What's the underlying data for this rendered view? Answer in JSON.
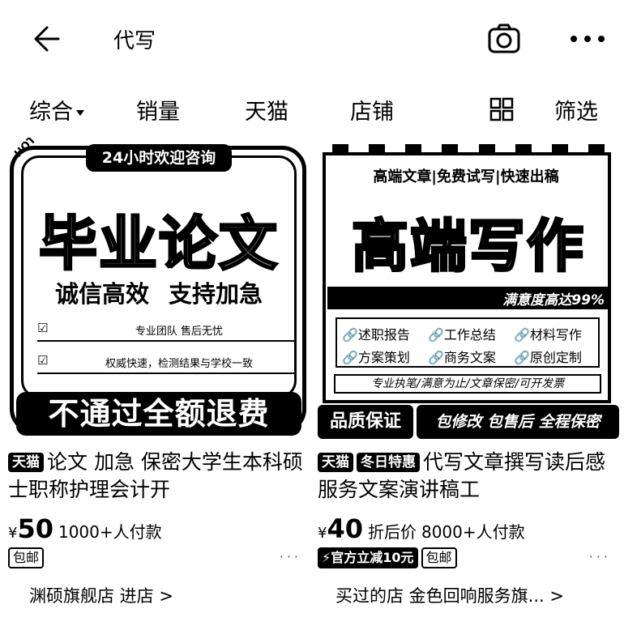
{
  "header": {
    "search_term": "代写"
  },
  "filters": {
    "items": [
      "综合",
      "销量",
      "天猫",
      "店铺",
      "筛选"
    ]
  },
  "products": [
    {
      "poster": {
        "hot": "HOT",
        "tag": "24小时欢迎咨询",
        "title": "毕业论文",
        "subtitle": "诚信高效 支持加急",
        "line1": "专业团队 售后无忧",
        "line2": "权威快速，检测结果与学校一致",
        "check": "☑",
        "banner": "不通过全额退费"
      },
      "badges": [
        "天猫"
      ],
      "title": "论文 加急 保密大学生本科硕士职称护理会计开",
      "yen": "¥",
      "price": "50",
      "price_note": "",
      "sold": "1000+人付款",
      "promo": "",
      "tag": "包邮",
      "shop": "渊硕旗舰店 进店 >"
    },
    {
      "poster": {
        "header": "高端文章|免费试写|快速出稿",
        "title": "高端写作",
        "bar": "满意度高达99%",
        "items": [
          "述职报告",
          "工作总结",
          "材料写作",
          "方案策划",
          "商务文案",
          "原创定制"
        ],
        "footer": "专业执笔/满意为止/文章保密/可开发票",
        "banner_left": "品质保证",
        "banner_right": "包修改 包售后 全程保密"
      },
      "badges": [
        "天猫",
        "冬日特惠"
      ],
      "title": "代写文章撰写读后感服务文案演讲稿工",
      "yen": "¥",
      "price": "40",
      "price_note": "折后价",
      "sold": "8000+人付款",
      "promo": "官方立减10元",
      "tag": "包邮",
      "shop": "买过的店 金色回响服务旗... >"
    }
  ]
}
